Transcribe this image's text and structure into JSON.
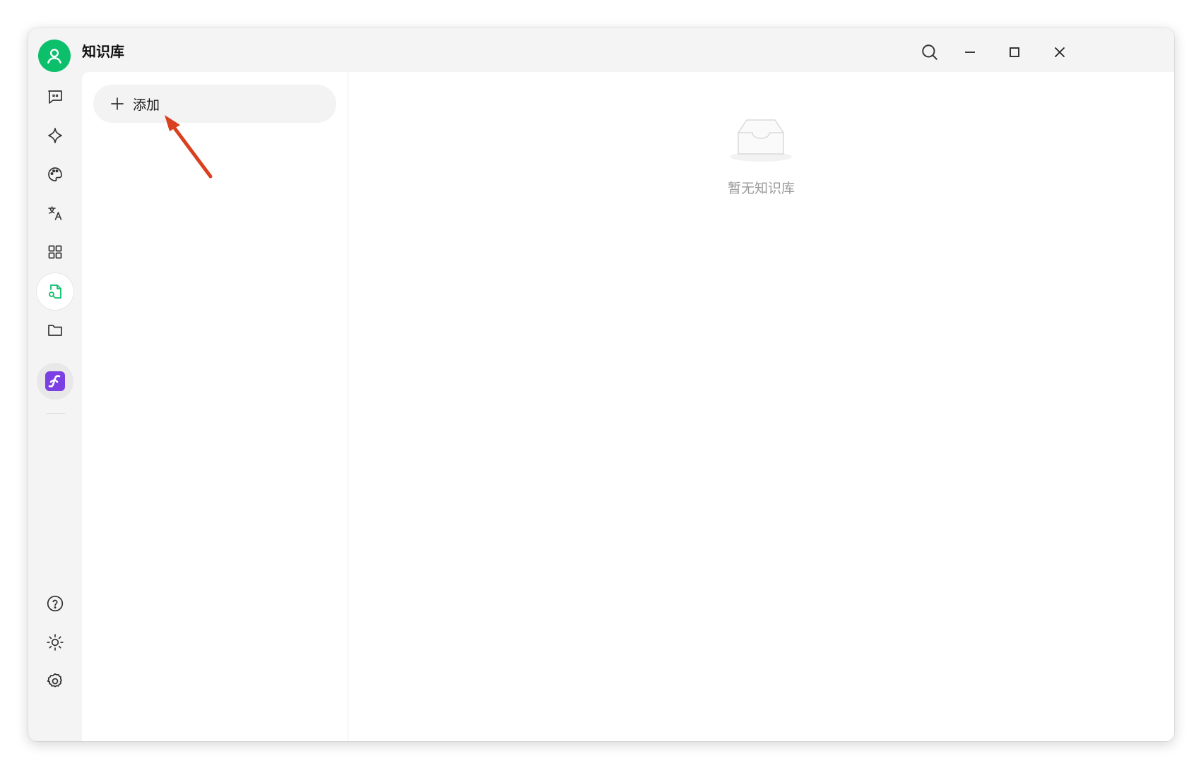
{
  "window": {
    "title": "知识库"
  },
  "titlebar": {
    "search_icon": "search-icon",
    "minimize_icon": "minimize-icon",
    "maximize_icon": "maximize-icon",
    "close_icon": "close-icon"
  },
  "sidebar": {
    "items": [
      {
        "name": "chat",
        "icon": "chat-bubble-icon"
      },
      {
        "name": "agents",
        "icon": "sparkle-icon"
      },
      {
        "name": "paintings",
        "icon": "palette-icon"
      },
      {
        "name": "translate",
        "icon": "translate-icon"
      },
      {
        "name": "apps",
        "icon": "grid-icon"
      },
      {
        "name": "knowledge",
        "icon": "file-search-icon",
        "active": true
      },
      {
        "name": "files",
        "icon": "folder-icon"
      }
    ],
    "pinned_app": {
      "icon": "app-logo-icon",
      "color": "#7b3fe4"
    },
    "bottom": [
      {
        "name": "help",
        "icon": "help-circle-icon"
      },
      {
        "name": "theme",
        "icon": "sun-icon"
      },
      {
        "name": "settings",
        "icon": "gear-icon"
      }
    ]
  },
  "knowledge_list": {
    "add_label": "添加"
  },
  "empty_state": {
    "text": "暂无知识库"
  },
  "colors": {
    "accent": "#0bbf6b",
    "annotation_arrow": "#d9401f"
  }
}
